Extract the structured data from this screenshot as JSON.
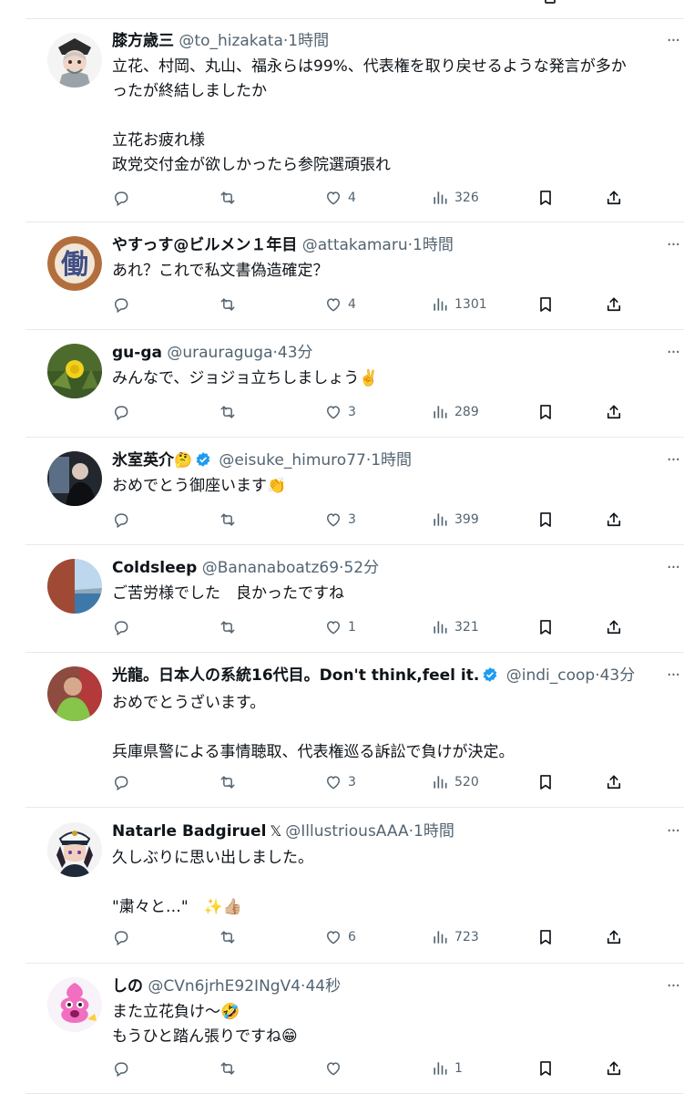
{
  "tweets": [
    {
      "name": "膝方歳三",
      "handle": "@to_hizakata",
      "time": "1時間",
      "verified": false,
      "x_badge": false,
      "name_emoji": "",
      "lines": [
        "立花、村岡、丸山、福永らは99%、代表権を取り戻せるような発言が多か",
        "ったが終結しましたか",
        "",
        "立花お疲れ様",
        "政党交付金が欲しかったら参院選頑張れ"
      ],
      "likes": "4",
      "views": "326",
      "avatar": "anime-character-avatar"
    },
    {
      "name": "やすっす@ビルメン１年目",
      "handle": "@attakamaru",
      "time": "1時間",
      "verified": false,
      "x_badge": false,
      "name_emoji": "",
      "lines": [
        "あれ？これで私文書偽造確定？"
      ],
      "likes": "4",
      "views": "1301",
      "avatar": "kanji-avatar",
      "avatar_text": "働"
    },
    {
      "name": "gu-ga",
      "handle": "@urauraguga",
      "time": "43分",
      "verified": false,
      "x_badge": false,
      "name_emoji": "",
      "lines": [
        "みんなで、ジョジョ立ちしましょう✌️"
      ],
      "likes": "3",
      "views": "289",
      "avatar": "dandelion-photo-avatar"
    },
    {
      "name": "氷室英介",
      "handle": "@eisuke_himuro77",
      "time": "1時間",
      "verified": true,
      "x_badge": false,
      "name_emoji": "🤔",
      "lines": [
        "おめでとう御座います👏"
      ],
      "likes": "3",
      "views": "399",
      "avatar": "person-photo-avatar"
    },
    {
      "name": "Coldsleep",
      "handle": "@Bananaboatz69",
      "time": "52分",
      "verified": false,
      "x_badge": false,
      "name_emoji": "",
      "lines": [
        "ご苦労様でした　良かったですね"
      ],
      "likes": "1",
      "views": "321",
      "avatar": "landscape-photo-avatar"
    },
    {
      "name": "光龍。日本人の系統16代目。Don't think,feel it.",
      "handle": "@indi_coop",
      "time": "43分",
      "verified": true,
      "x_badge": false,
      "name_emoji": "",
      "lines": [
        "おめでとうざいます。",
        "",
        "兵庫県警による事情聴取、代表権巡る訴訟で負けが決定。"
      ],
      "likes": "3",
      "views": "520",
      "avatar": "person-green-shirt-avatar"
    },
    {
      "name": "Natarle Badgiruel",
      "handle": "@IllustriousAAA",
      "time": "1時間",
      "verified": false,
      "x_badge": true,
      "x_symbol": "𝕏",
      "name_emoji": "",
      "lines": [
        "久しぶりに思い出しました。",
        "",
        "\"粛々と…\"　✨👍🏼"
      ],
      "likes": "6",
      "views": "723",
      "avatar": "anime-officer-avatar"
    },
    {
      "name": "しの",
      "handle": "@CVn6jrhE92INgV4",
      "time": "44秒",
      "verified": false,
      "x_badge": false,
      "name_emoji": "",
      "lines": [
        "また立花負け〜🤣",
        "もうひと踏ん張りですね😁"
      ],
      "likes": "",
      "views": "1",
      "avatar": "pink-character-avatar"
    }
  ],
  "ui": {
    "dot": "·",
    "more": "···"
  },
  "colors": {
    "text": "#0f1419",
    "secondary": "#536471",
    "verified": "#1d9bf0",
    "divider": "#e6e9eb"
  }
}
